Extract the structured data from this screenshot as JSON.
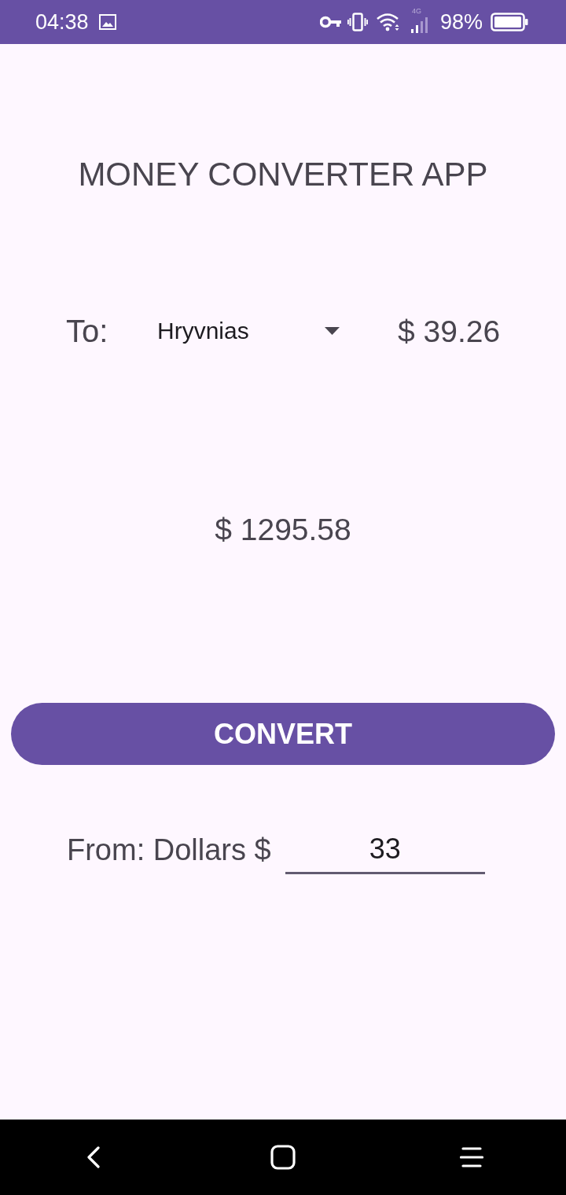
{
  "status_bar": {
    "time": "04:38",
    "network": "4G",
    "battery": "98%"
  },
  "title": "MONEY CONVERTER APP",
  "to": {
    "label": "To:",
    "currency": "Hryvnias",
    "rate": "$ 39.26"
  },
  "result": "$ 1295.58",
  "convert_button": "CONVERT",
  "from": {
    "label": "From: Dollars $",
    "value": "33"
  }
}
